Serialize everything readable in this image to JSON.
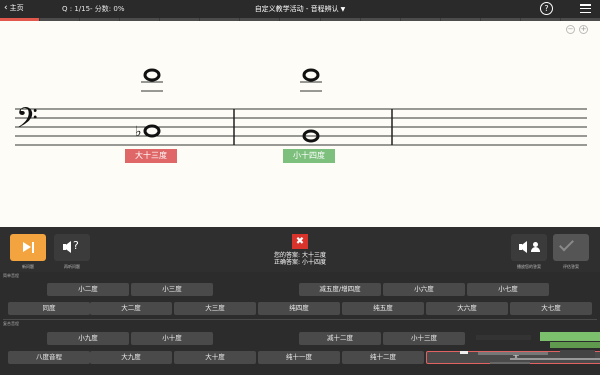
{
  "topbar": {
    "home_label": "主页",
    "question_info": "Q : 1/15- 分数: 0%",
    "title": "自定义教学活动 - 音程辨认",
    "help_label": "?"
  },
  "progress": {
    "total": 15,
    "current": 1
  },
  "staff": {
    "clef": "𝄢",
    "interval_labels": [
      {
        "text": "大十三度",
        "color": "#e06767"
      },
      {
        "text": "小十四度",
        "color": "#7dc07d"
      }
    ]
  },
  "controls": {
    "next_caption": "新问题",
    "replay_caption": "再听问题",
    "result_icon": "✖",
    "your_answer": "您的答案: 大十三度",
    "correct_answer": "正确答案: 小十四度",
    "play_answer_caption": "播放您的答案",
    "check_caption": "评估答案"
  },
  "sections": {
    "simple": "简单音程",
    "compound": "复合音程"
  },
  "interval_rows": [
    [
      "小二度",
      "小三度",
      "减五度/增四度",
      "小六度",
      "小七度"
    ],
    [
      "同度",
      "大二度",
      "大三度",
      "纯四度",
      "纯五度",
      "大六度",
      "大七度"
    ],
    [
      "小九度",
      "小十度",
      "减十二度",
      "小十三度"
    ],
    [
      "八度音程",
      "大九度",
      "大十度",
      "纯十一度",
      "纯十二度",
      "大"
    ]
  ],
  "colors": {
    "accent": "#f3a43f",
    "wrong": "#e06767",
    "correct": "#7dc07d",
    "error_icon": "#d9342b"
  }
}
